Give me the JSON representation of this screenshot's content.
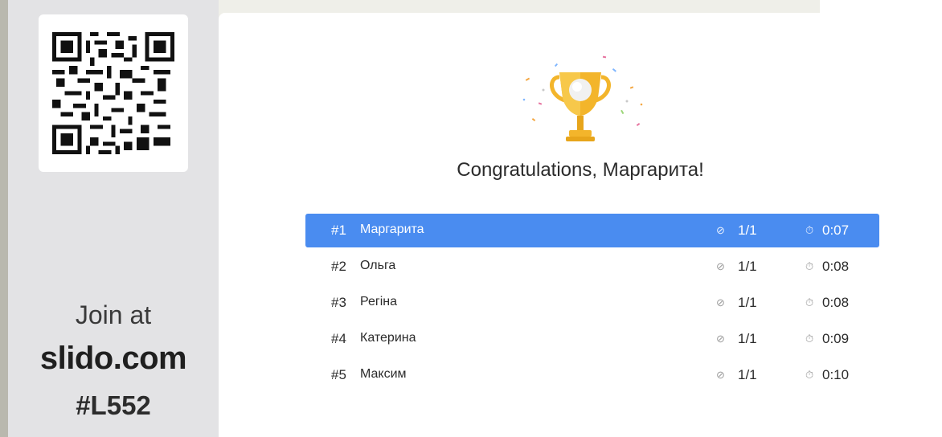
{
  "join": {
    "line1": "Join at",
    "site": "slido.com",
    "code": "#L552"
  },
  "result": {
    "congrats": "Congratulations, Маргарита!"
  },
  "icons": {
    "trophy": "trophy-icon",
    "correct": "check-circle-icon",
    "timer": "stopwatch-icon"
  },
  "colors": {
    "highlight": "#4a8cf0",
    "trophy": "#f3b52b",
    "sidebar": "#e3e3e5"
  },
  "leaderboard": [
    {
      "rank": "#1",
      "name": "Маргарита",
      "score": "1/1",
      "time": "0:07"
    },
    {
      "rank": "#2",
      "name": "Ольга",
      "score": "1/1",
      "time": "0:08"
    },
    {
      "rank": "#3",
      "name": "Регіна",
      "score": "1/1",
      "time": "0:08"
    },
    {
      "rank": "#4",
      "name": "Катерина",
      "score": "1/1",
      "time": "0:09"
    },
    {
      "rank": "#5",
      "name": "Максим",
      "score": "1/1",
      "time": "0:10"
    }
  ]
}
